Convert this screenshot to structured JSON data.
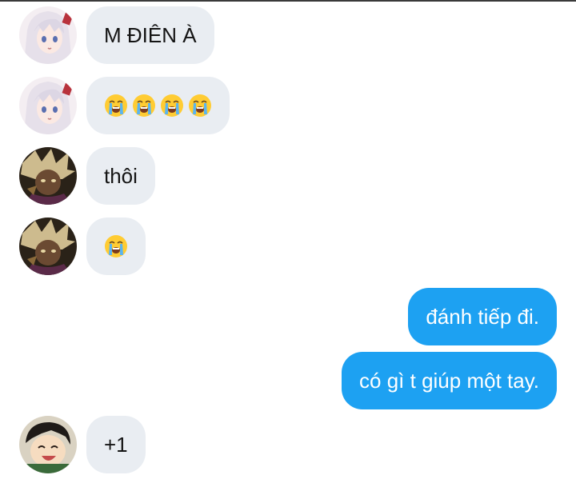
{
  "messages": [
    {
      "id": "m1",
      "side": "in",
      "avatar": "silver-hair-anime-avatar",
      "text": "M ĐIÊN À"
    },
    {
      "id": "m2",
      "side": "in",
      "avatar": "silver-hair-anime-avatar",
      "emojis": [
        "loudly-crying-face-icon",
        "loudly-crying-face-icon",
        "loudly-crying-face-icon",
        "loudly-crying-face-icon"
      ]
    },
    {
      "id": "m3",
      "side": "in",
      "avatar": "dark-anime-avatar",
      "text": "thôi"
    },
    {
      "id": "m4",
      "side": "in",
      "avatar": "dark-anime-avatar",
      "emojis": [
        "loudly-crying-face-icon"
      ]
    },
    {
      "id": "m5",
      "side": "out",
      "text": "đánh tiếp đi."
    },
    {
      "id": "m6",
      "side": "out",
      "text": "có gì t giúp một tay."
    },
    {
      "id": "m7",
      "side": "in",
      "avatar": "laughing-kid-avatar",
      "text": "+1"
    }
  ],
  "colors": {
    "incoming_bubble": "#e9edf2",
    "outgoing_bubble": "#1da1f2",
    "incoming_text": "#141414",
    "outgoing_text": "#ffffff"
  }
}
